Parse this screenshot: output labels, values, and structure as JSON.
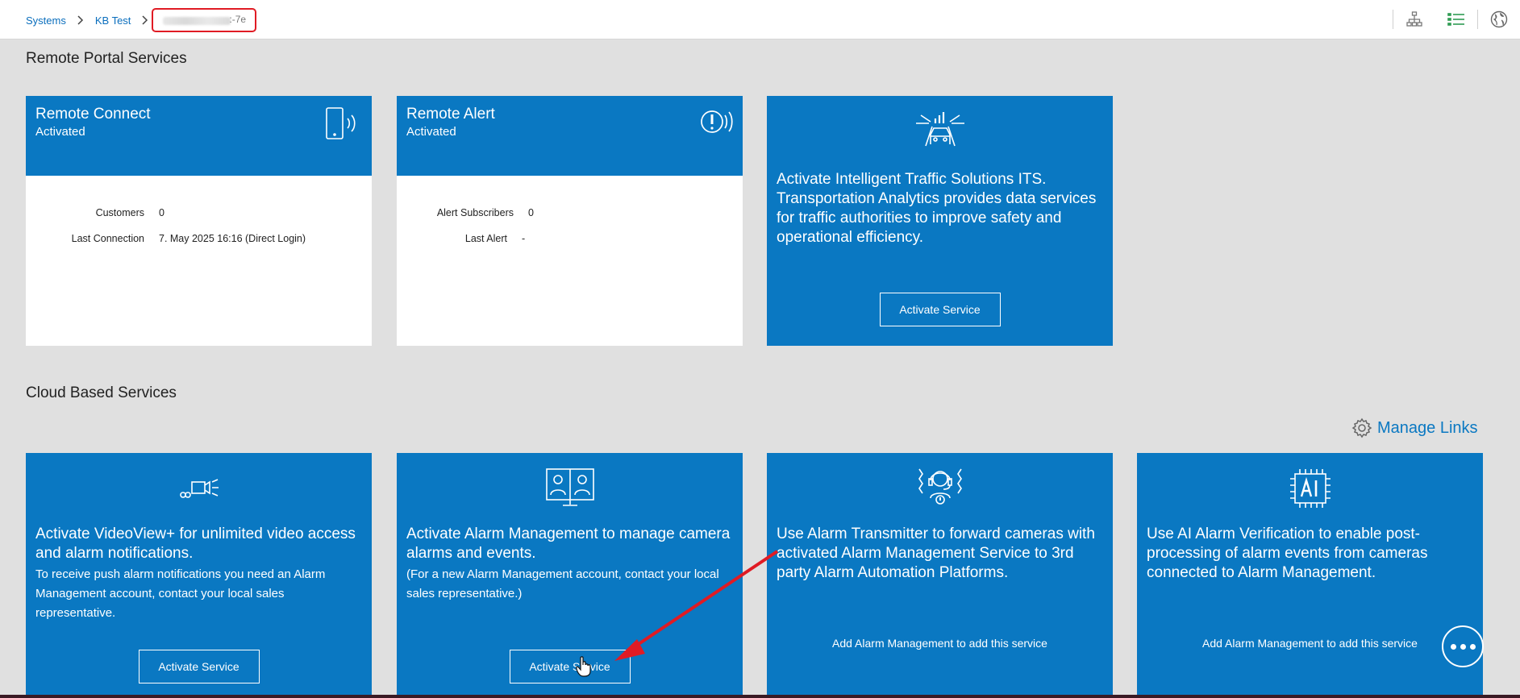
{
  "breadcrumb": {
    "items": [
      "Systems",
      "KB Test"
    ],
    "current_suffix": ":-7e"
  },
  "topbar_icons": [
    "sitemap-icon",
    "list-view-icon",
    "globe-icon"
  ],
  "colors": {
    "accent": "#0a78c2",
    "highlight": "#e01b24",
    "background": "#e0e0e0"
  },
  "remote_portal": {
    "title": "Remote Portal Services",
    "remote_connect": {
      "name": "Remote Connect",
      "status": "Activated",
      "stats": [
        {
          "label": "Customers",
          "value": "0"
        },
        {
          "label": "Last Connection",
          "value": "7. May 2025 16:16 (Direct Login)"
        }
      ]
    },
    "remote_alert": {
      "name": "Remote Alert",
      "status": "Activated",
      "stats": [
        {
          "label": "Alert Subscribers",
          "value": "0"
        },
        {
          "label": "Last Alert",
          "value": "-"
        }
      ]
    },
    "its": {
      "text": "Activate Intelligent Traffic Solutions ITS. Transportation Analytics provides data services for traffic authorities to improve safety and operational efficiency.",
      "button": "Activate Service"
    }
  },
  "cloud": {
    "title": "Cloud Based Services",
    "manage_links": "Manage Links",
    "videoview": {
      "headline": "Activate VideoView+ for unlimited video access and alarm notifications.",
      "sub": "To receive push alarm notifications you need an Alarm Management account, contact your local sales representative.",
      "button": "Activate Service"
    },
    "alarm_management": {
      "headline": "Activate Alarm Management to manage camera alarms and events.",
      "sub": "(For a new Alarm Management account, contact your local sales representative.)",
      "button": "Activate Service"
    },
    "alarm_transmitter": {
      "headline": "Use Alarm Transmitter to forward cameras with activated Alarm Management Service to 3rd party Alarm Automation Platforms.",
      "note": "Add Alarm Management to add this service"
    },
    "ai_verification": {
      "headline": "Use AI Alarm Verification to enable post-processing of alarm events from cameras connected to Alarm Management.",
      "note": "Add Alarm Management to add this service"
    }
  }
}
